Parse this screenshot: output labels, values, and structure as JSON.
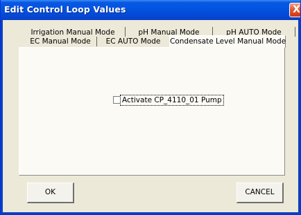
{
  "window": {
    "title": "Edit Control Loop Values",
    "close_glyph": "X"
  },
  "tabs": {
    "back_row": [
      {
        "label": "Irrigation Manual Mode"
      },
      {
        "label": "pH Manual Mode"
      },
      {
        "label": "pH AUTO Mode"
      }
    ],
    "front_row": [
      {
        "label": "EC Manual Mode"
      },
      {
        "label": "EC AUTO Mode"
      },
      {
        "label": "Condensate Level Manual Mode",
        "selected": true
      }
    ]
  },
  "panel": {
    "checkbox": {
      "label": "Activate CP_4110_01 Pump",
      "checked": false
    }
  },
  "buttons": {
    "ok_label": "OK",
    "cancel_label": "CANCEL"
  },
  "colors": {
    "titlebar": "#0254e0",
    "window_bg": "#ece9d8",
    "panel_bg": "#fbfaf5",
    "close_button": "#e35a36"
  }
}
